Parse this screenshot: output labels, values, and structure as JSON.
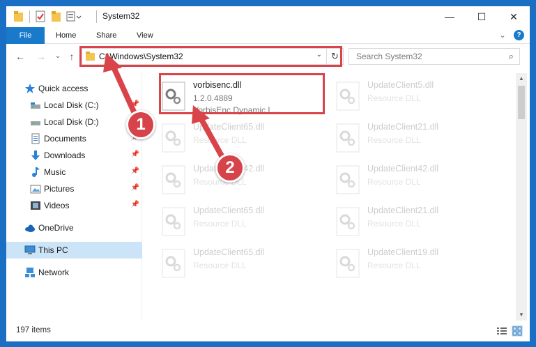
{
  "window": {
    "title": "System32",
    "controls": {
      "minimize": "—",
      "maximize": "☐",
      "close": "✕"
    }
  },
  "ribbon": {
    "tabs": [
      "File",
      "Home",
      "Share",
      "View"
    ],
    "expand_glyph": "⌄",
    "help_glyph": "?"
  },
  "navigation": {
    "back": "←",
    "forward": "→",
    "recent": "⌄",
    "up": "↑",
    "address": "C:\\Windows\\System32",
    "address_dropdown": "⌄",
    "refresh": "↻",
    "search_placeholder": "Search System32",
    "search_glyph": "⌕"
  },
  "sidebar": {
    "items": [
      {
        "label": "Quick access",
        "icon": "star-icon",
        "pinned": false
      },
      {
        "label": "Local Disk (C:)",
        "icon": "drive-icon",
        "pinned": true
      },
      {
        "label": "Local Disk (D:)",
        "icon": "drive-icon",
        "pinned": false
      },
      {
        "label": "Documents",
        "icon": "documents-icon",
        "pinned": true
      },
      {
        "label": "Downloads",
        "icon": "downloads-icon",
        "pinned": true
      },
      {
        "label": "Music",
        "icon": "music-icon",
        "pinned": true
      },
      {
        "label": "Pictures",
        "icon": "pictures-icon",
        "pinned": true
      },
      {
        "label": "Videos",
        "icon": "videos-icon",
        "pinned": true
      },
      {
        "label": "OneDrive",
        "icon": "onedrive-icon",
        "pinned": false
      },
      {
        "label": "This PC",
        "icon": "this-pc-icon",
        "pinned": false,
        "selected": true
      },
      {
        "label": "Network",
        "icon": "network-icon",
        "pinned": false
      }
    ],
    "pin_glyph": "📌"
  },
  "files": [
    {
      "name": "vorbisenc.dll",
      "version": "1.2.0.4889",
      "description": "VorbisEnc Dynamic L...",
      "highlighted": true
    },
    {
      "name": "UpdateClient5.dll",
      "version": "",
      "description": "Resource DLL",
      "highlighted": false
    },
    {
      "name": "UpdateClient65.dll",
      "version": "",
      "description": "Resource DLL",
      "highlighted": false
    },
    {
      "name": "UpdateClient21.dll",
      "version": "",
      "description": "Resource DLL",
      "highlighted": false
    },
    {
      "name": "UpdateClient42.dll",
      "version": "",
      "description": "Resource DLL",
      "highlighted": false
    },
    {
      "name": "UpdateClient42.dll",
      "version": "",
      "description": "Resource DLL",
      "highlighted": false
    },
    {
      "name": "UpdateClient65.dll",
      "version": "",
      "description": "Resource DLL",
      "highlighted": false
    },
    {
      "name": "UpdateClient21.dll",
      "version": "",
      "description": "Resource DLL",
      "highlighted": false
    },
    {
      "name": "UpdateClient65.dll",
      "version": "",
      "description": "Resource DLL",
      "highlighted": false
    },
    {
      "name": "UpdateClient19.dll",
      "version": "",
      "description": "Resource DLL",
      "highlighted": false
    }
  ],
  "status": {
    "item_count": "197 items"
  },
  "annotations": {
    "step1": "1",
    "step2": "2",
    "color": "#d9434a"
  },
  "colors": {
    "accent": "#1979ca",
    "selected": "#cce4f7",
    "desktop": "#1a6fc4"
  }
}
